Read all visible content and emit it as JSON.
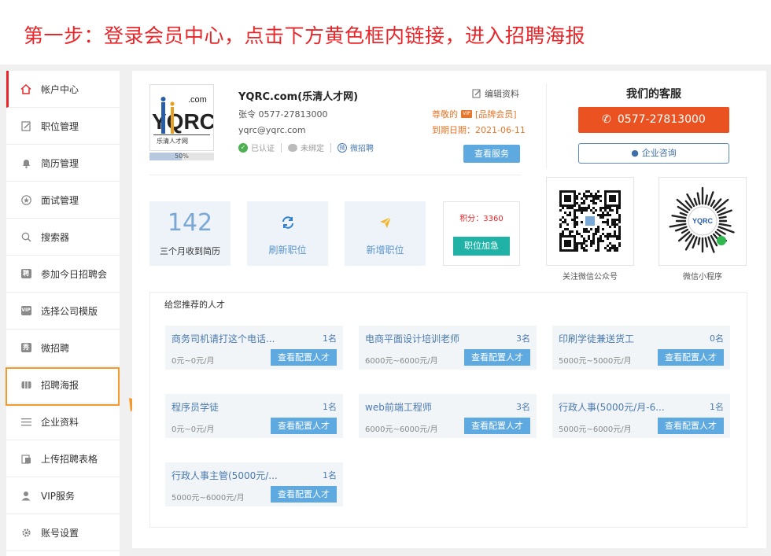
{
  "banner": {
    "title": "第一步：登录会员中心，点击下方黄色框内链接，进入招聘海报"
  },
  "sidebar": {
    "items": [
      {
        "label": "帐户中心",
        "icon": "home-icon",
        "active": true
      },
      {
        "label": "职位管理",
        "icon": "edit-icon"
      },
      {
        "label": "简历管理",
        "icon": "bell-icon"
      },
      {
        "label": "面试管理",
        "icon": "star-icon"
      },
      {
        "label": "搜索器",
        "icon": "search-icon"
      },
      {
        "label": "参加今日招聘会",
        "icon": "hire-icon",
        "glyph": "聘"
      },
      {
        "label": "选择公司模版",
        "icon": "vip-icon",
        "glyph": "VIP"
      },
      {
        "label": "微招聘",
        "icon": "show-icon",
        "glyph": "秀"
      },
      {
        "label": "招聘海报",
        "icon": "poster-icon",
        "highlighted": true
      },
      {
        "label": "企业资料",
        "icon": "list-icon"
      },
      {
        "label": "上传招聘表格",
        "icon": "upload-icon"
      },
      {
        "label": "VIP服务",
        "icon": "user-icon"
      },
      {
        "label": "账号设置",
        "icon": "gear-icon"
      }
    ]
  },
  "profile": {
    "logo_text": "YQRC",
    "logo_com": ".com",
    "logo_sub": "乐清人才网",
    "progress_label": "50%",
    "progress": 0.5,
    "company_name": "YQRC.com(乐清人才网)",
    "contact": "张令  0577-27813000",
    "email": "yqrc@yqrc.com",
    "verified": "已认证",
    "unbound": "未绑定",
    "micro_hire": "微招聘",
    "edit_label": "编辑资料",
    "member_prefix": "尊敬的",
    "vip_badge": "VIP",
    "member_level": "[品牌会员]",
    "expire": "到期日期：2021-06-11",
    "view_service": "查看服务"
  },
  "stats": {
    "resume_count": "142",
    "resume_label": "三个月收到简历",
    "refresh_label": "刷新职位",
    "add_label": "新增职位",
    "points": "积分：3360",
    "boost_label": "职位加急"
  },
  "customer_service": {
    "title": "我们的客服",
    "phone": "0577-27813000",
    "consult": "企业咨询",
    "qr_wechat_label": "关注微信公众号",
    "qr_mini_label": "微信小程序"
  },
  "recommend": {
    "title": "给您推荐的人才",
    "button_label": "查看配置人才",
    "items": [
      {
        "name": "商务司机请打这个电话...",
        "count": "1名",
        "salary": "0元~0元/月"
      },
      {
        "name": "电商平面设计培训老师",
        "count": "3名",
        "salary": "6000元~6000元/月"
      },
      {
        "name": "印刷学徒兼送货工",
        "count": "0名",
        "salary": "5000元~5000元/月"
      },
      {
        "name": "程序员学徒",
        "count": "1名",
        "salary": "0元~0元/月"
      },
      {
        "name": "web前端工程师",
        "count": "3名",
        "salary": "6000元~6000元/月"
      },
      {
        "name": "行政人事(5000元/月-6...",
        "count": "1名",
        "salary": "5000元~6000元/月"
      },
      {
        "name": "行政人事主管(5000元/...",
        "count": "1名",
        "salary": "5000元~6000元/月"
      }
    ]
  },
  "colors": {
    "accent_red": "#e8262a",
    "highlight_orange": "#f29a2e",
    "button_blue": "#5ea9e0",
    "phone_orange": "#ea5321",
    "teal": "#20b2a6"
  }
}
